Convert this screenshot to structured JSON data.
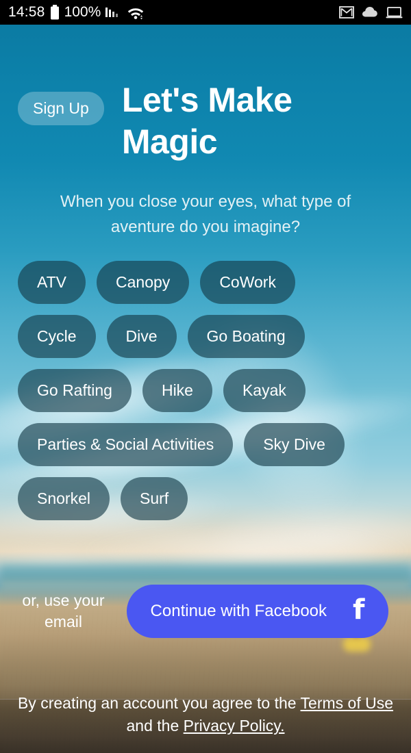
{
  "status_bar": {
    "time": "14:58",
    "battery_percent": "100%",
    "icons_left": [
      "battery-icon",
      "signal-bars-icon",
      "wifi-icon"
    ],
    "icons_right": [
      "gmail-icon",
      "cloud-icon",
      "laptop-icon"
    ]
  },
  "header": {
    "signup_label": "Sign Up",
    "title_line1": "Let's Make",
    "title_line2": "Magic"
  },
  "prompt": {
    "question": "When you close your eyes, what type of aventure do you imagine?"
  },
  "interests": {
    "rows": [
      [
        "ATV",
        "Canopy",
        "CoWork"
      ],
      [
        "Cycle",
        "Dive",
        "Go Boating"
      ],
      [
        "Go Rafting",
        "Hike",
        "Kayak"
      ],
      [
        "Parties & Social Activities",
        "Sky Dive"
      ],
      [
        "Snorkel",
        "Surf"
      ]
    ]
  },
  "cta": {
    "email_line1": "or, use your",
    "email_line2": "email",
    "facebook_label": "Continue with Facebook",
    "facebook_icon": "facebook-f-icon",
    "facebook_color": "#4a57f2"
  },
  "legal": {
    "prefix": "By creating an account you agree to the ",
    "terms_label": "Terms of Use",
    "middle": " and the ",
    "privacy_label": "Privacy Policy.",
    "suffix": ""
  },
  "theme": {
    "top_teal": "#0b7ba3",
    "chip_fill": "rgba(20,56,70,0.62)",
    "accent_blue": "#4a57f2"
  }
}
